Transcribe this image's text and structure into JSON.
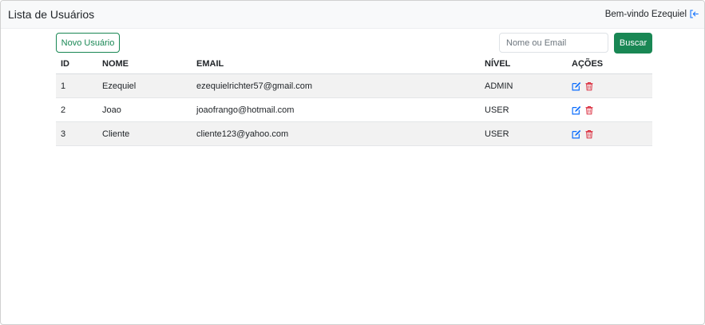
{
  "header": {
    "title": "Lista de Usuários",
    "welcome": "Bem-vindo Ezequiel",
    "logout_icon": "logout-icon"
  },
  "toolbar": {
    "new_user_label": "Novo Usuário",
    "search_placeholder": "Nome ou Email",
    "search_value": "",
    "search_label": "Buscar"
  },
  "table": {
    "columns": [
      "ID",
      "NOME",
      "EMAIL",
      "NÍVEL",
      "AÇÕES"
    ],
    "rows": [
      {
        "id": "1",
        "nome": "Ezequiel",
        "email": "ezequielrichter57@gmail.com",
        "nivel": "ADMIN"
      },
      {
        "id": "2",
        "nome": "Joao",
        "email": "joaofrango@hotmail.com",
        "nivel": "USER"
      },
      {
        "id": "3",
        "nome": "Cliente",
        "email": "cliente123@yahoo.com",
        "nivel": "USER"
      }
    ],
    "action_icons": [
      "edit-icon",
      "trash-icon"
    ]
  },
  "colors": {
    "primary_green": "#198754",
    "edit_blue": "#0d6efd",
    "delete_red": "#dc3545",
    "navbar_bg": "#f8f9fa",
    "striped_row": "#f2f2f2"
  }
}
